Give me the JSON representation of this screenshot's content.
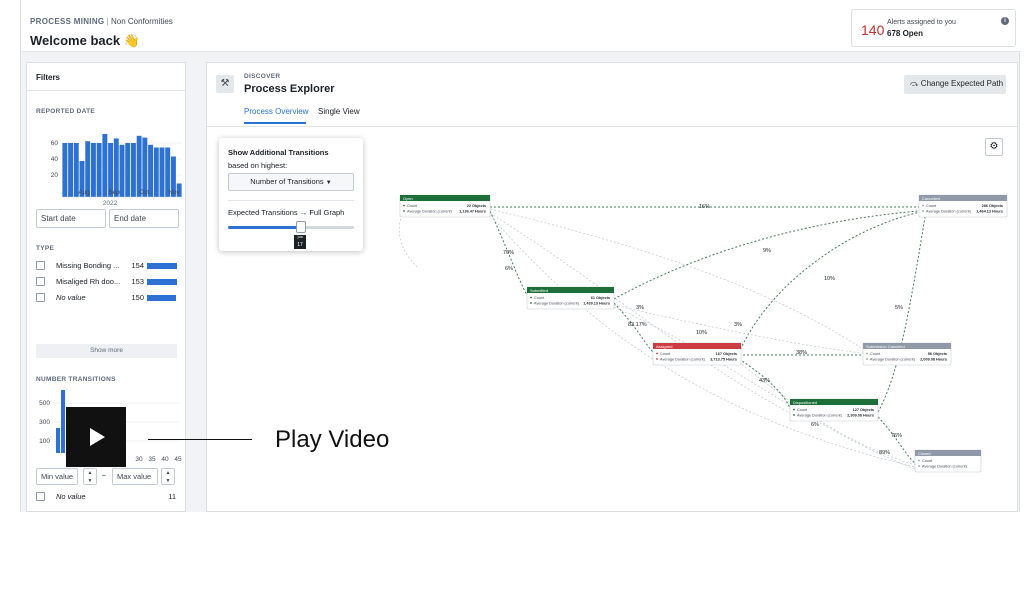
{
  "header": {
    "product": "PROCESS MINING",
    "section": "Non Conformities",
    "welcome": "Welcome back",
    "welcome_emoji": "👋",
    "alerts_count": "140",
    "alerts_label": "Alerts assigned to you",
    "alerts_open": "678 Open"
  },
  "filters": {
    "title": "Filters",
    "reported_date": {
      "title": "REPORTED DATE",
      "y_ticks": [
        "60",
        "40",
        "20"
      ],
      "months": [
        "Aug",
        "Sep",
        "Oct",
        "Nov"
      ],
      "year": "2022",
      "bars": [
        60,
        60,
        60,
        40,
        62,
        60,
        60,
        70,
        60,
        65,
        58,
        60,
        60,
        68,
        66,
        58,
        55,
        55,
        55,
        45,
        15
      ],
      "start_placeholder": "Start date",
      "end_placeholder": "End date"
    },
    "type": {
      "title": "TYPE",
      "items": [
        {
          "label": "Missing Bonding ...",
          "count": "154",
          "bar": 1.0,
          "italic": false
        },
        {
          "label": "Misaliged Rh doo...",
          "count": "153",
          "bar": 0.99,
          "italic": false
        },
        {
          "label": "No value",
          "count": "150",
          "bar": 0.97,
          "italic": true
        }
      ],
      "show_more": "Show more"
    },
    "number_transitions": {
      "title": "NUMBER TRANSITIONS",
      "y_ticks": [
        "500",
        "300",
        "100"
      ],
      "x_ticks": [
        "30",
        "35",
        "40",
        "45"
      ],
      "min_placeholder": "Min value",
      "max_placeholder": "Max value",
      "dash": "–",
      "no_value_label": "No value",
      "no_value_count": "11"
    }
  },
  "main": {
    "kicker": "DISCOVER",
    "title": "Process Explorer",
    "tabs": [
      {
        "label": "Process Overview"
      },
      {
        "label": "Single View"
      }
    ],
    "change_path": "Change Expected Path",
    "popup": {
      "title": "Show Additional Transitions",
      "subtitle": "based on highest:",
      "select": "Number of Transitions",
      "expected": "Expected Transitions",
      "full": "Full Graph",
      "tooltip_top": ">=",
      "tooltip_val": "17"
    },
    "graph": {
      "nodes": [
        {
          "title": "Open",
          "count": "22 Objects",
          "dur": "1,136.47 Hours",
          "color": "#1e6e3a"
        },
        {
          "title": "Cancelled",
          "count": "286 Objects",
          "dur": "1,464.13 Hours",
          "color": "#8f99a8"
        },
        {
          "title": "Submitted",
          "count": "61 Objects",
          "dur": "1,439.13 Hours",
          "color": "#1e6e3a"
        },
        {
          "title": "Assigned",
          "count": "167 Objects",
          "dur": "3,713.75 Hours",
          "color": "#cd3c42"
        },
        {
          "title": "Submission Canceled",
          "count": "56 Objects",
          "dur": "2,009.08 Hours",
          "color": "#8f99a8"
        },
        {
          "title": "Dispositioned",
          "count": "127 Objects",
          "dur": "2,309.08 Hours",
          "color": "#1e6e3a"
        },
        {
          "title": "Closed",
          "count": "",
          "dur": "",
          "color": "#8f99a8"
        }
      ],
      "count_label": "Count",
      "dur_label": "Average Duration (current)",
      "edge_labels": [
        "16%",
        "70%",
        "6%",
        "9%",
        "10%",
        "3%",
        "83.17%",
        "10%",
        "3%",
        "38%",
        "43%",
        "6%",
        "5%",
        "76%",
        "89%"
      ]
    }
  },
  "video": {
    "label": "Play Video"
  }
}
